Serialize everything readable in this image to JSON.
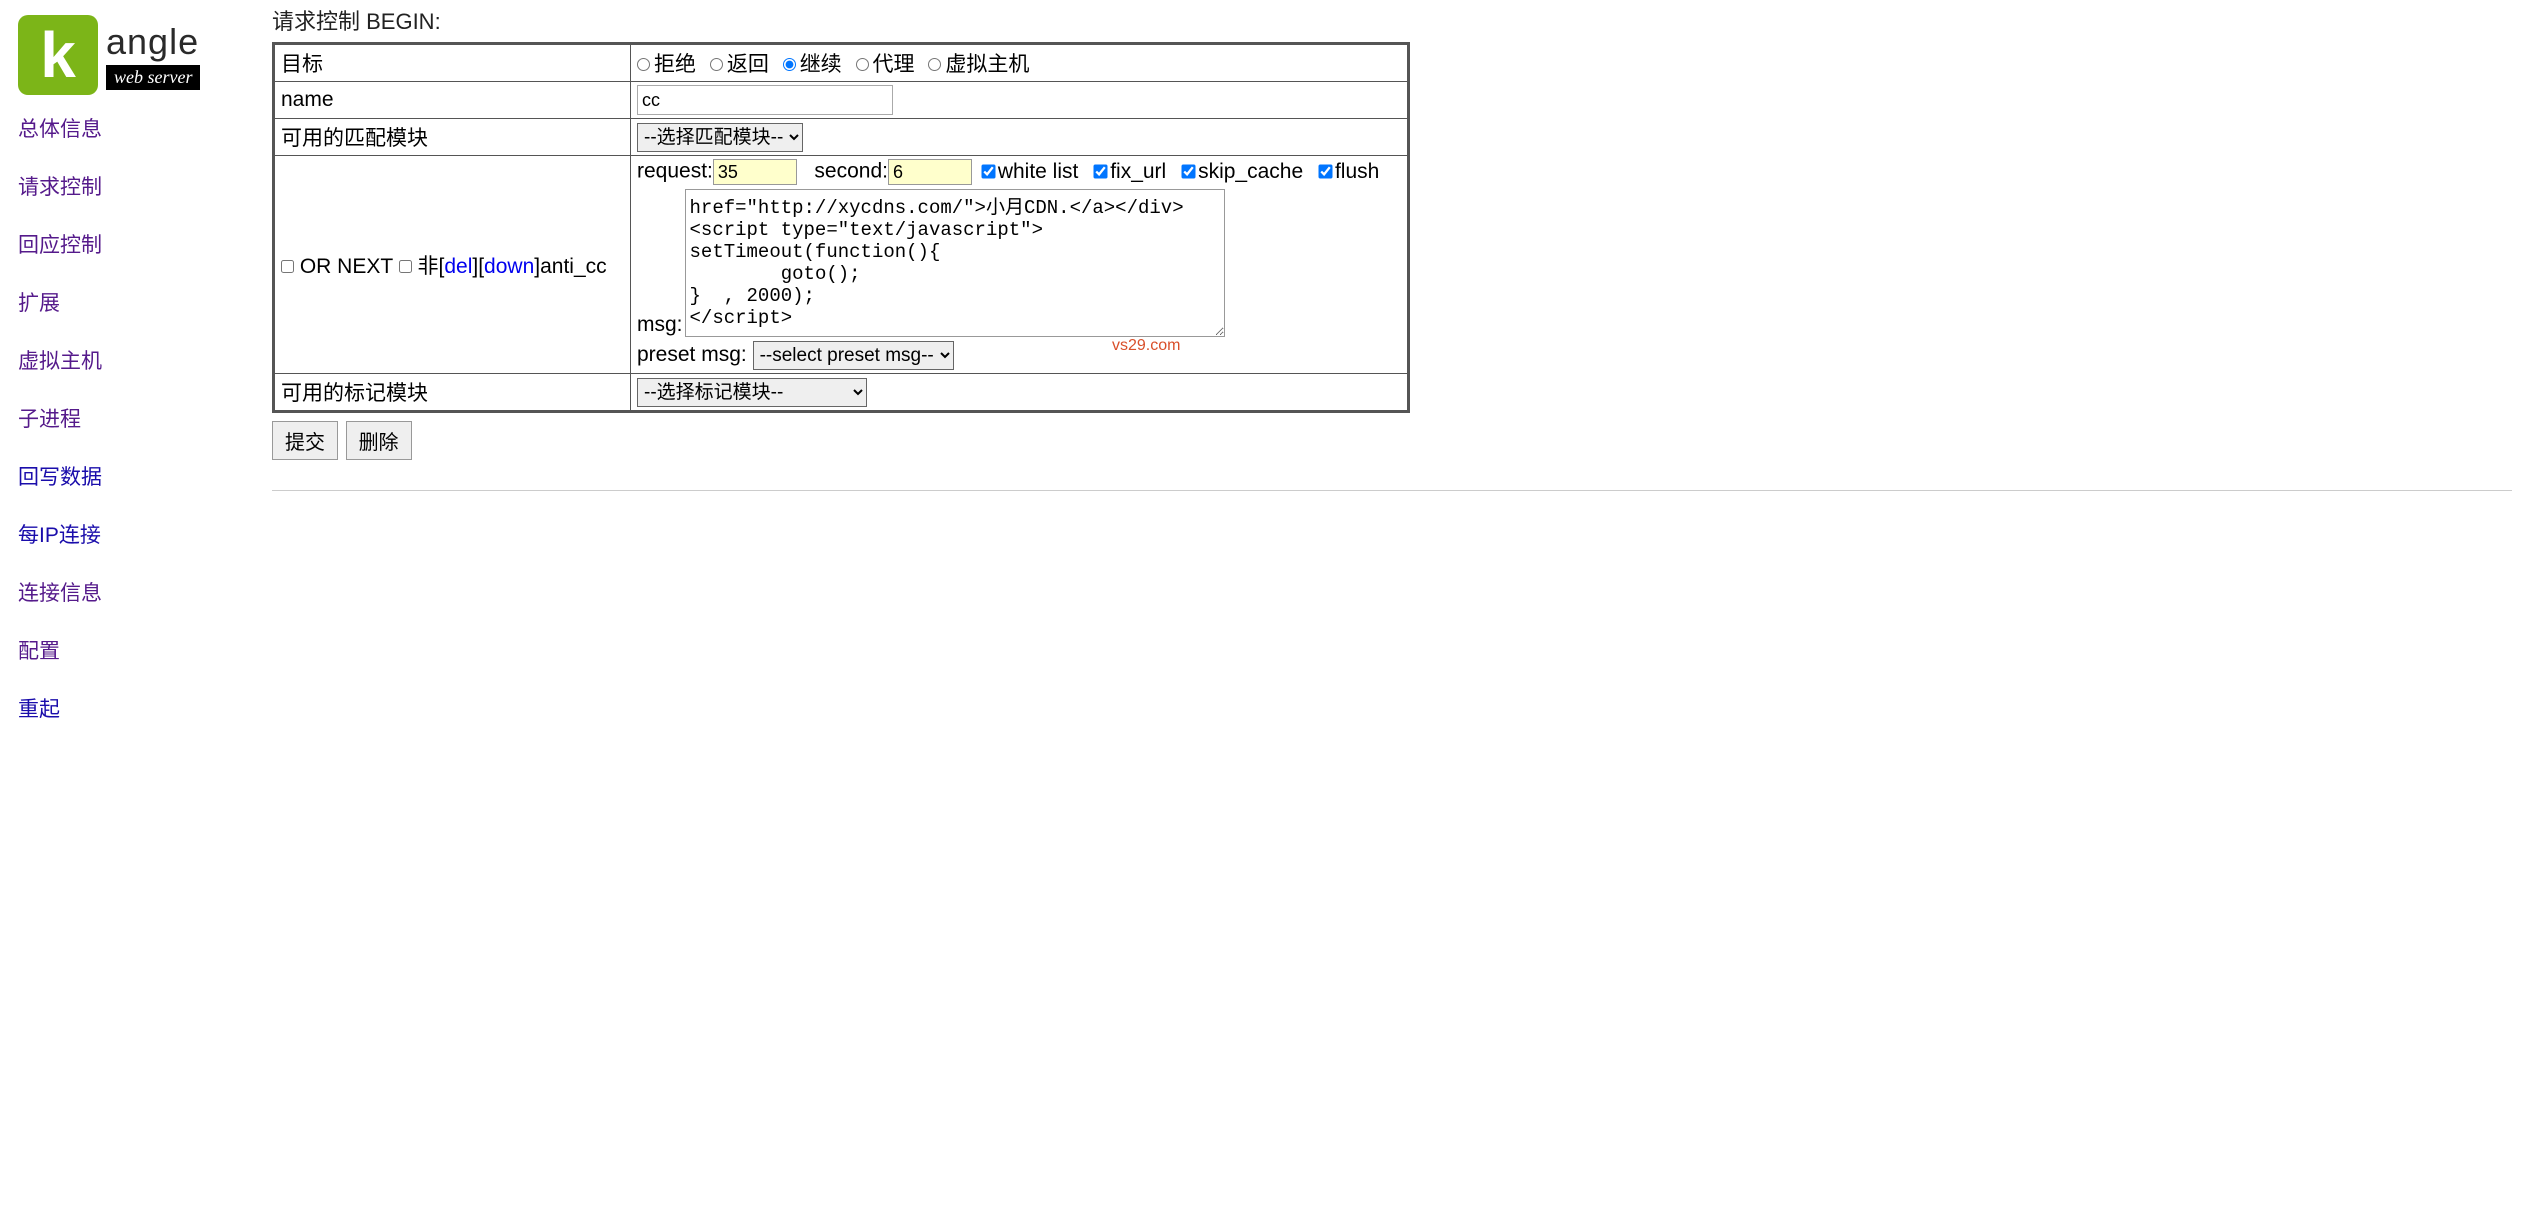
{
  "logo": {
    "k": "k",
    "angle": "angle",
    "sub": "web server"
  },
  "nav": [
    {
      "label": "总体信息",
      "visited": true
    },
    {
      "label": "请求控制",
      "visited": true
    },
    {
      "label": "回应控制",
      "visited": true
    },
    {
      "label": "扩展",
      "visited": true
    },
    {
      "label": "虚拟主机",
      "visited": true
    },
    {
      "label": "子进程",
      "visited": true
    },
    {
      "label": "回写数据",
      "visited": false
    },
    {
      "label": "每IP连接",
      "visited": false
    },
    {
      "label": "连接信息",
      "visited": true
    },
    {
      "label": "配置",
      "visited": true
    },
    {
      "label": "重起",
      "visited": false
    }
  ],
  "page_title": "请求控制 BEGIN:",
  "rows": {
    "target_label": "目标",
    "target_options": {
      "reject": "拒绝",
      "return": "返回",
      "continue": "继续",
      "proxy": "代理",
      "vhost": "虚拟主机"
    },
    "target_selected": "continue",
    "name_label": "name",
    "name_value": "cc",
    "match_label": "可用的匹配模块",
    "match_select": "--选择匹配模块--",
    "or_next": "OR NEXT",
    "fei": "非",
    "del": "del",
    "down": "down",
    "anticc": "anti_cc",
    "request_label": "request:",
    "request_value": "35",
    "second_label": "second:",
    "second_value": "6",
    "chk_whitelist": "white list",
    "chk_fixurl": "fix_url",
    "chk_skipcache": "skip_cache",
    "chk_flush": "flush",
    "msg_label": "msg:",
    "msg_value": "href=\"http://xycdns.com/\">小月CDN.</a></div>\n<script type=\"text/javascript\">\nsetTimeout(function(){\n        goto();\n}  , 2000);\n</script>",
    "preset_label": "preset msg:",
    "preset_select": "--select preset msg--",
    "mark_label": "可用的标记模块",
    "mark_select": "--选择标记模块--"
  },
  "buttons": {
    "submit": "提交",
    "delete": "删除"
  },
  "watermark": "vs29.com"
}
